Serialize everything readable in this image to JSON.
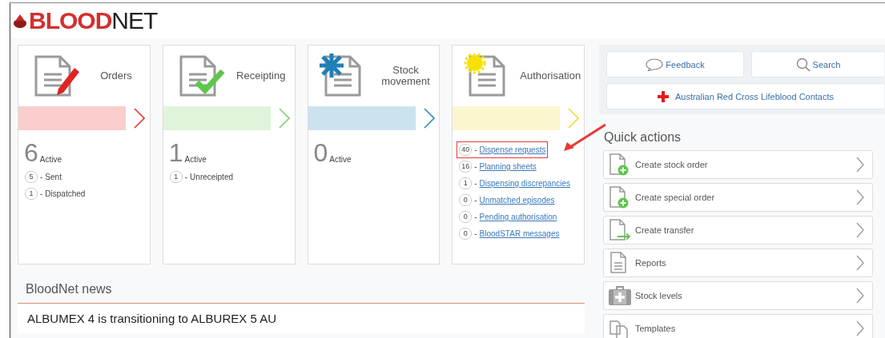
{
  "logo": {
    "text": "**BLOOD**NET"
  },
  "tiles": [
    {
      "kind": "orders",
      "title": "Orders",
      "color": "#e53935",
      "count": "6",
      "count_label": "Active",
      "items": [
        {
          "count": "5",
          "dash": "-",
          "label": "Sent",
          "link": false,
          "highlighted": false
        },
        {
          "count": "1",
          "dash": "-",
          "label": "Dispatched",
          "link": false,
          "highlighted": false
        }
      ]
    },
    {
      "kind": "receipting",
      "title": "Receipting",
      "color": "#7ed36a",
      "count": "1",
      "count_label": "Active",
      "items": [
        {
          "count": "1",
          "dash": "-",
          "label": "Unreceipted",
          "link": false,
          "highlighted": false
        }
      ]
    },
    {
      "kind": "movement",
      "title": "Stock movement",
      "color": "#2f8fc0",
      "count": "0",
      "count_label": "Active"
    },
    {
      "kind": "authorisation",
      "title": "Authorisation",
      "color": "#f2d93a",
      "items": [
        {
          "count": "40",
          "dash": "-",
          "label": "Dispense requests",
          "link": true,
          "highlighted": true
        },
        {
          "count": "16",
          "dash": "-",
          "label": "Planning sheets",
          "link": true,
          "highlighted": false
        },
        {
          "count": "1",
          "dash": "-",
          "label": "Dispensing discrepancies",
          "link": true,
          "highlighted": false
        },
        {
          "count": "0",
          "dash": "-",
          "label": "Unmatched episodes",
          "link": true,
          "highlighted": false
        },
        {
          "count": "0",
          "dash": "-",
          "label": "Pending authorisation",
          "link": true,
          "highlighted": false
        },
        {
          "count": "0",
          "dash": "-",
          "label": "BloodSTAR messages",
          "link": true,
          "highlighted": false
        }
      ]
    }
  ],
  "tools": {
    "feedback": "Feedback",
    "search": "Search",
    "contacts": "Australian Red Cross Lifeblood Contacts"
  },
  "quick_actions": {
    "title": "Quick actions",
    "items": [
      {
        "kind": "add",
        "label": "Create stock order"
      },
      {
        "kind": "add",
        "label": "Create special order"
      },
      {
        "kind": "transfer",
        "label": "Create transfer"
      },
      {
        "kind": "report",
        "label": "Reports"
      },
      {
        "kind": "kit",
        "label": "Stock levels"
      },
      {
        "kind": "templates",
        "label": "Templates"
      }
    ]
  },
  "news": {
    "title": "BloodNet news",
    "items": [
      "ALBUMEX 4 is transitioning to ALBUREX 5 AU"
    ]
  }
}
